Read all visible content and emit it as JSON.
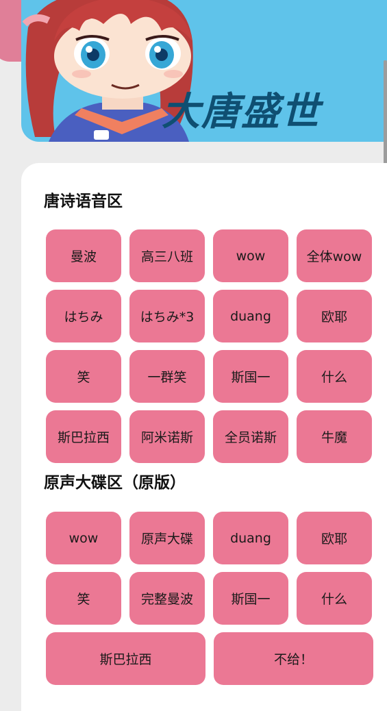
{
  "banner": {
    "title": "大唐盛世"
  },
  "tang_section": {
    "title": "唐诗语音区",
    "buttons": [
      "曼波",
      "高三八班",
      "wow",
      "全体wow",
      "はちみ",
      "はちみ*3",
      "duang",
      "欧耶",
      "笑",
      "一群笑",
      "斯国一",
      "什么",
      "斯巴拉西",
      "阿米诺斯",
      "全员诺斯",
      "牛魔"
    ]
  },
  "soundtrack_section": {
    "title": "原声大碟区（原版）",
    "buttons": [
      "wow",
      "原声大碟",
      "duang",
      "欧耶",
      "笑",
      "完整曼波",
      "斯国一",
      "什么"
    ],
    "wide_buttons": [
      "斯巴拉西",
      "不给！"
    ]
  },
  "colors": {
    "banner_bg": "#5fc3ea",
    "button_pink": "#eb7894",
    "title_navy": "#0f4f72"
  }
}
